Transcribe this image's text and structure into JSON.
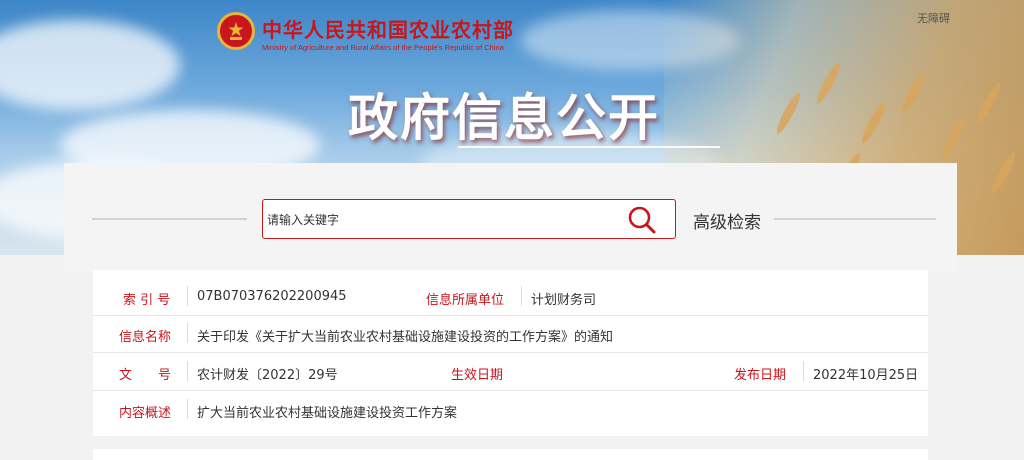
{
  "header": {
    "ministry_cn": "中华人民共和国农业农村部",
    "ministry_en": "Ministry of Agriculture and Rural Affairs of the People's Republic of China",
    "accessibility_link": "无障碍",
    "hero_title": "政府信息公开",
    "emblem_icon": "national-emblem-icon"
  },
  "search": {
    "placeholder": "请输入关键字",
    "button_icon": "search-icon",
    "advanced_label": "高级检索"
  },
  "info": {
    "index_label": "索 引 号",
    "index_value": "07B070376202200945",
    "unit_label": "信息所属单位",
    "unit_value": "计划财务司",
    "name_label": "信息名称",
    "name_value": "关于印发《关于扩大当前农业农村基础设施建设投资的工作方案》的通知",
    "doc_label": "文　　号",
    "doc_value": "农计财发〔2022〕29号",
    "effective_label": "生效日期",
    "effective_value": "",
    "publish_label": "发布日期",
    "publish_value": "2022年10月25日",
    "summary_label": "内容概述",
    "summary_value": "扩大当前农业农村基础设施建设投资工作方案"
  },
  "colors": {
    "accent": "#c8161d",
    "gold": "#e7b538",
    "text": "#333333"
  }
}
